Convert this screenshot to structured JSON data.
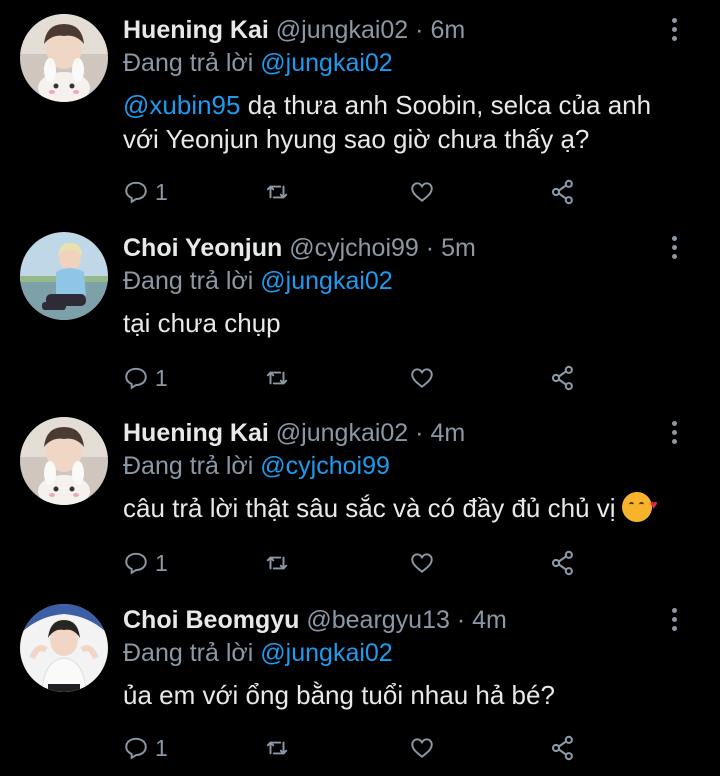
{
  "tweets": [
    {
      "name": "Huening Kai",
      "handle": "@jungkai02",
      "sep": "·",
      "time": "6m",
      "reply_prefix": "Đang trả lời",
      "reply_to": "@jungkai02",
      "mention": "@xubin95",
      "text": " dạ thưa anh Soobin, selca của anh với Yeonjun hyung sao giờ chưa thấy ạ?",
      "reply_count": "1",
      "avatar": "huening-avatar"
    },
    {
      "name": "Choi Yeonjun",
      "handle": "@cyjchoi99",
      "sep": "·",
      "time": "5m",
      "reply_prefix": "Đang trả lời",
      "reply_to": "@jungkai02",
      "mention": "",
      "text": "tại chưa chụp",
      "reply_count": "1",
      "avatar": "yeonjun-avatar"
    },
    {
      "name": "Huening Kai",
      "handle": "@jungkai02",
      "sep": "·",
      "time": "4m",
      "reply_prefix": "Đang trả lời",
      "reply_to": "@cyjchoi99",
      "mention": "",
      "text": "câu trả lời thật sâu sắc và có đầy đủ chủ vị",
      "emoji": "smiling-face-with-hearts",
      "reply_count": "1",
      "avatar": "huening-avatar"
    },
    {
      "name": "Choi Beomgyu",
      "handle": "@beargyu13",
      "sep": "·",
      "time": "4m",
      "reply_prefix": "Đang trả lời",
      "reply_to": "@jungkai02",
      "mention": "",
      "text": "ủa em với ổng bằng tuổi nhau hả bé?",
      "reply_count": "1",
      "avatar": "beomgyu-avatar"
    }
  ],
  "colors": {
    "background": "#000000",
    "link": "#1d9bf0",
    "secondary": "#8b98a5",
    "primary_text": "#e7e9ea"
  },
  "icons": [
    "reply-icon",
    "retweet-icon",
    "like-icon",
    "share-icon",
    "more-options-icon"
  ]
}
